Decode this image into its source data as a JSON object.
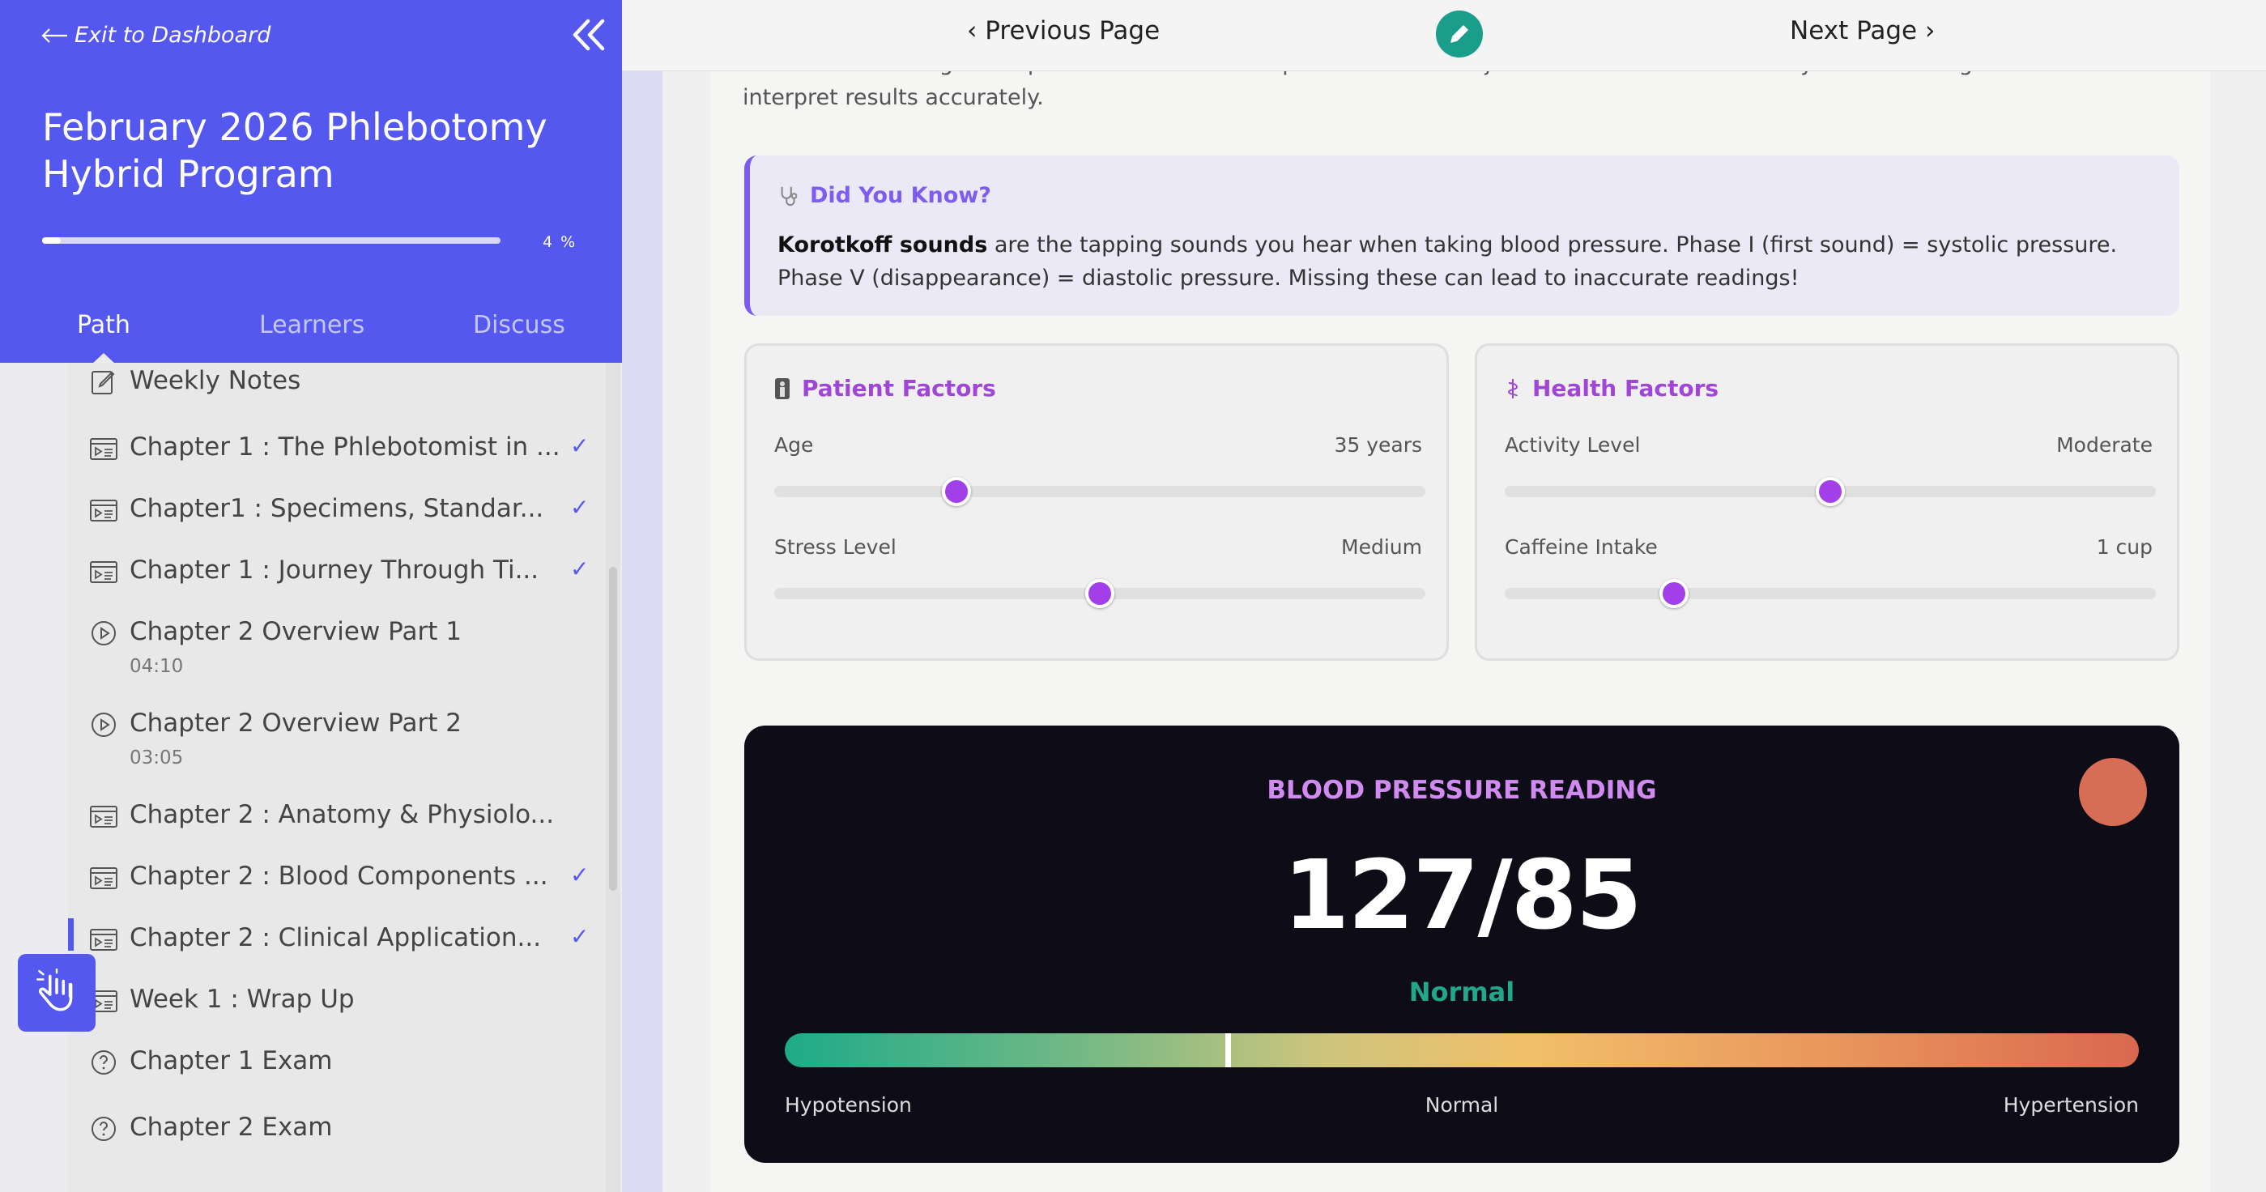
{
  "sidebar": {
    "exit_label": "Exit to Dashboard",
    "course_title": "February 2026 Phlebotomy Hybrid Program",
    "progress_percent": 4,
    "progress_label": "4 %",
    "tabs": [
      {
        "label": "Path",
        "active": true
      },
      {
        "label": "Learners",
        "active": false
      },
      {
        "label": "Discuss",
        "active": false
      }
    ],
    "lessons": [
      {
        "title": "Weekly Notes",
        "type": "notes",
        "duration": "",
        "completed": false
      },
      {
        "title": "Chapter 1 : The Phlebotomist in ...",
        "type": "interactive",
        "duration": "",
        "completed": true
      },
      {
        "title": "Chapter1 : Specimens, Standar...",
        "type": "interactive",
        "duration": "",
        "completed": true
      },
      {
        "title": "Chapter 1 : Journey Through Ti...",
        "type": "interactive",
        "duration": "",
        "completed": true
      },
      {
        "title": "Chapter 2 Overview Part 1",
        "type": "video",
        "duration": "04:10",
        "completed": false
      },
      {
        "title": "Chapter 2 Overview Part 2",
        "type": "video",
        "duration": "03:05",
        "completed": false
      },
      {
        "title": "Chapter 2 : Anatomy & Physiolo...",
        "type": "interactive",
        "duration": "",
        "completed": false
      },
      {
        "title": "Chapter 2 : Blood Components ...",
        "type": "interactive",
        "duration": "",
        "completed": true
      },
      {
        "title": "Chapter 2 : Clinical Application...",
        "type": "interactive",
        "duration": "",
        "completed": true,
        "current": true
      },
      {
        "title": "Week 1 : Wrap Up",
        "type": "interactive",
        "duration": "",
        "completed": false
      },
      {
        "title": "Chapter 1 Exam",
        "type": "quiz",
        "duration": "",
        "completed": false
      },
      {
        "title": "Chapter 2 Exam",
        "type": "quiz",
        "duration": "",
        "completed": false
      }
    ]
  },
  "topbar": {
    "prev_label": "Previous Page",
    "next_label": "Next Page"
  },
  "content": {
    "intro": "Practice measuring blood pressure with different patient factors. Adjust variables to see how they affect readings and learn to interpret results accurately.",
    "tip": {
      "title": "Did You Know?",
      "bold": "Korotkoff sounds",
      "text": " are the tapping sounds you hear when taking blood pressure. Phase I (first sound) = systolic pressure. Phase V (disappearance) = diastolic pressure. Missing these can lead to inaccurate readings!"
    },
    "patient_factors": {
      "title": "Patient Factors",
      "sliders": [
        {
          "label": "Age",
          "value": "35 years",
          "fraction": 0.28
        },
        {
          "label": "Stress Level",
          "value": "Medium",
          "fraction": 0.5
        }
      ]
    },
    "health_factors": {
      "title": "Health Factors",
      "sliders": [
        {
          "label": "Activity Level",
          "value": "Moderate",
          "fraction": 0.5
        },
        {
          "label": "Caffeine Intake",
          "value": "1 cup",
          "fraction": 0.26
        }
      ]
    },
    "reading": {
      "title": "BLOOD PRESSURE READING",
      "value": "127/85",
      "status": "Normal",
      "indicator_color": "#d76d55",
      "gauge_fraction": 0.327,
      "scale_labels": [
        "Hypotension",
        "Normal",
        "Hypertension"
      ]
    }
  },
  "colors": {
    "sidebar_accent": "#5558ef",
    "slider_thumb": "#a23fe8",
    "status_normal": "#21a88a",
    "edit_button": "#1a9d8b"
  }
}
